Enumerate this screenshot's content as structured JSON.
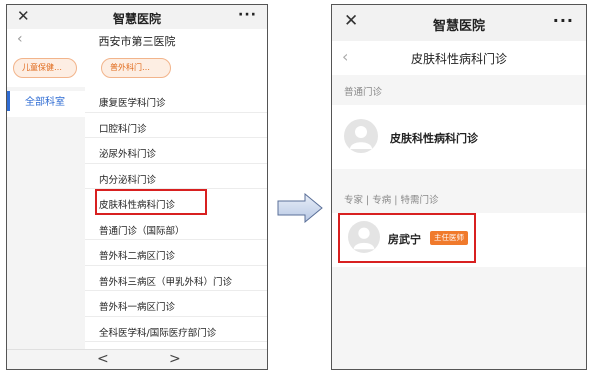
{
  "left": {
    "app_title": "智慧医院",
    "close_icon": "close-icon",
    "more_icon": "more-icon",
    "back_icon": "chevron-left-icon",
    "hospital_name": "西安市第三医院",
    "chips": [
      "儿童保健…",
      "普外科门…"
    ],
    "sidebar_selected": "全部科室",
    "departments": [
      "康复医学科门诊",
      "口腔科门诊",
      "泌尿外科门诊",
      "内分泌科门诊",
      "皮肤科性病科门诊",
      "普通门诊（国际部）",
      "普外科二病区门诊",
      "普外科三病区（甲乳外科）门诊",
      "普外科一病区门诊",
      "全科医学科/国际医疗部门诊"
    ],
    "highlighted_index": 4,
    "nav_prev": "<",
    "nav_next": ">"
  },
  "right": {
    "app_title": "智慧医院",
    "close_icon": "close-icon",
    "more_icon": "more-icon",
    "back_icon": "chevron-left-icon",
    "department_title": "皮肤科性病科门诊",
    "section_general": "普通门诊",
    "general_clinic_name": "皮肤科性病科门诊",
    "section_expert": "专家 | 专病 | 特需门诊",
    "doctor_name": "房武宁",
    "doctor_title": "主任医师"
  },
  "colors": {
    "accent_blue": "#2f6cd3",
    "highlight_red": "#d82020",
    "badge_orange": "#f07a2c",
    "chip_orange": "#e06a1b"
  },
  "arrow_icon": "right-arrow-icon"
}
